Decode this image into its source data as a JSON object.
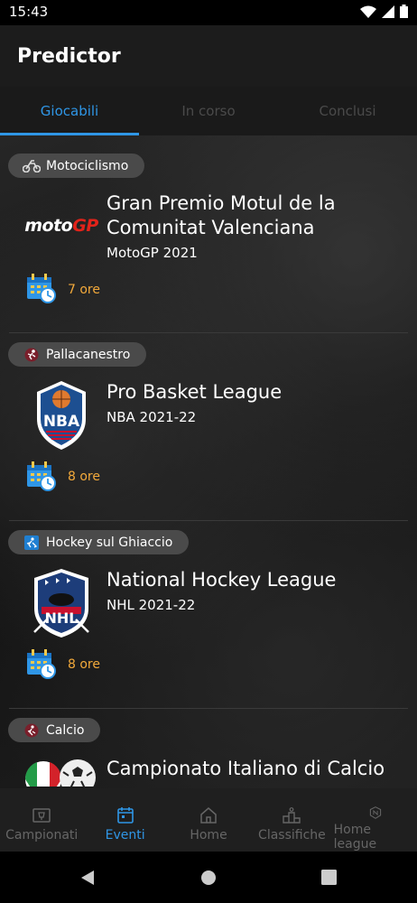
{
  "status": {
    "time": "15:43"
  },
  "app": {
    "title": "Predictor"
  },
  "tabs": [
    {
      "label": "Giocabili",
      "active": true
    },
    {
      "label": "In corso",
      "active": false
    },
    {
      "label": "Conclusi",
      "active": false
    }
  ],
  "events": [
    {
      "category": "Motociclismo",
      "category_icon": "motorcycle-icon",
      "logo_text": "motoGP",
      "title": "Gran Premio Motul de la Comunitat Valenciana",
      "subtitle": "MotoGP 2021",
      "time_left": "7 ore"
    },
    {
      "category": "Pallacanestro",
      "category_icon": "basketball-player-icon",
      "logo_text": "NBA",
      "title": "Pro Basket League",
      "subtitle": "NBA 2021-22",
      "time_left": "8 ore"
    },
    {
      "category": "Hockey sul Ghiaccio",
      "category_icon": "hockey-icon",
      "logo_text": "NHL",
      "title": "National Hockey League",
      "subtitle": "NHL 2021-22",
      "time_left": "8 ore"
    },
    {
      "category": "Calcio",
      "category_icon": "soccer-player-icon",
      "title": "Campionato Italiano di Calcio"
    }
  ],
  "bottom_nav": [
    {
      "label": "Campionati",
      "icon": "trophy-board-icon",
      "active": false
    },
    {
      "label": "Eventi",
      "icon": "calendar-icon",
      "active": true
    },
    {
      "label": "Home",
      "icon": "home-icon",
      "active": false
    },
    {
      "label": "Classifiche",
      "icon": "podium-icon",
      "active": false
    },
    {
      "label": "Home league",
      "icon": "league-badge-icon",
      "active": false
    }
  ],
  "colors": {
    "accent": "#2f96e6",
    "time_orange": "#f2a93b",
    "chip_bg": "#4a4a4a"
  }
}
